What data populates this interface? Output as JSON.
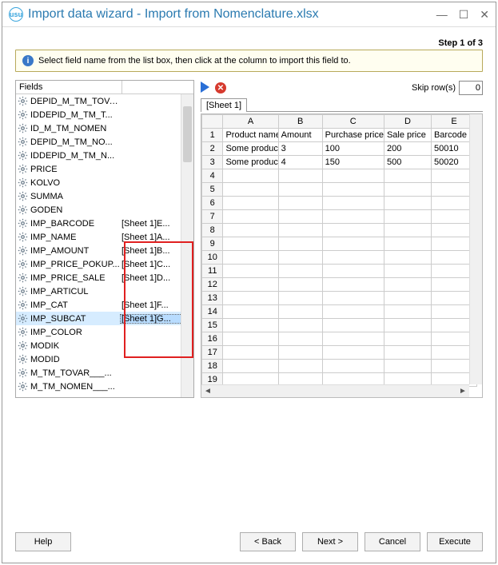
{
  "window": {
    "title": "Import data wizard - Import from Nomenclature.xlsx",
    "step_label": "Step 1 of 3"
  },
  "info": {
    "text": "Select field name from the list box, then click at the column to import this field to."
  },
  "fields_panel": {
    "header": "Fields",
    "items": [
      {
        "name": "DEPID_M_TM_TOVAR",
        "map": ""
      },
      {
        "name": "IDDEPID_M_TM_T...",
        "map": ""
      },
      {
        "name": "ID_M_TM_NOMEN",
        "map": ""
      },
      {
        "name": "DEPID_M_TM_NO...",
        "map": ""
      },
      {
        "name": "IDDEPID_M_TM_N...",
        "map": ""
      },
      {
        "name": "PRICE",
        "map": ""
      },
      {
        "name": "KOLVO",
        "map": ""
      },
      {
        "name": "SUMMA",
        "map": ""
      },
      {
        "name": "GODEN",
        "map": ""
      },
      {
        "name": "IMP_BARCODE",
        "map": "[Sheet 1]E..."
      },
      {
        "name": "IMP_NAME",
        "map": "[Sheet 1]A..."
      },
      {
        "name": "IMP_AMOUNT",
        "map": "[Sheet 1]B..."
      },
      {
        "name": "IMP_PRICE_POKUP...",
        "map": "[Sheet 1]C..."
      },
      {
        "name": "IMP_PRICE_SALE",
        "map": "[Sheet 1]D..."
      },
      {
        "name": "IMP_ARTICUL",
        "map": ""
      },
      {
        "name": "IMP_CAT",
        "map": "[Sheet 1]F..."
      },
      {
        "name": "IMP_SUBCAT",
        "map": "[Sheet 1]G...",
        "selected": true
      },
      {
        "name": "IMP_COLOR",
        "map": ""
      },
      {
        "name": "MODIK",
        "map": ""
      },
      {
        "name": "MODID",
        "map": ""
      },
      {
        "name": "M_TM_TOVAR___...",
        "map": ""
      },
      {
        "name": "M_TM_NOMEN___...",
        "map": ""
      }
    ]
  },
  "right": {
    "skip_label": "Skip row(s)",
    "skip_value": "0",
    "tab_label": "[Sheet 1]",
    "columns": [
      "A",
      "B",
      "C",
      "D",
      "E"
    ],
    "rows": [
      [
        "Product name",
        "Amount",
        "Purchase price",
        "Sale price",
        "Barcode"
      ],
      [
        "Some product",
        "3",
        "100",
        "200",
        "50010"
      ],
      [
        "Some product",
        "4",
        "150",
        "500",
        "50020"
      ]
    ],
    "total_visible_rows": 19
  },
  "buttons": {
    "help": "Help",
    "back": "< Back",
    "next": "Next >",
    "cancel": "Cancel",
    "execute": "Execute"
  }
}
